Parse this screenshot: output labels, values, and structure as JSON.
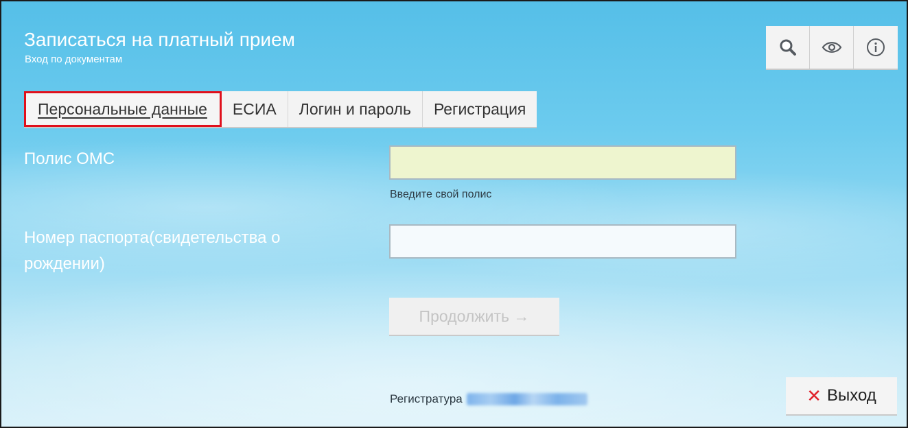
{
  "header": {
    "title": "Записаться на платный прием",
    "subtitle": "Вход по документам"
  },
  "toolbar": {
    "icons": [
      "search-icon",
      "eye-icon",
      "info-icon"
    ]
  },
  "tabs": [
    {
      "label": "Персональные данные",
      "active": true
    },
    {
      "label": "ЕСИА",
      "active": false
    },
    {
      "label": "Логин и пароль",
      "active": false
    },
    {
      "label": "Регистрация",
      "active": false
    }
  ],
  "form": {
    "oms_label": "Полис ОМС",
    "oms_value": "",
    "oms_hint": "Введите свой полис",
    "passport_label_line1": "Номер паспорта(свидетельства о",
    "passport_label_line2": "рождении)",
    "passport_value": "",
    "continue_label": "Продолжить →"
  },
  "footer": {
    "registry_label": "Регистратура",
    "exit_label": "Выход",
    "exit_icon": "close-icon"
  },
  "colors": {
    "highlight_border": "#e0101c",
    "oms_field_bg": "#eef5cf",
    "exit_x": "#e0222b"
  }
}
